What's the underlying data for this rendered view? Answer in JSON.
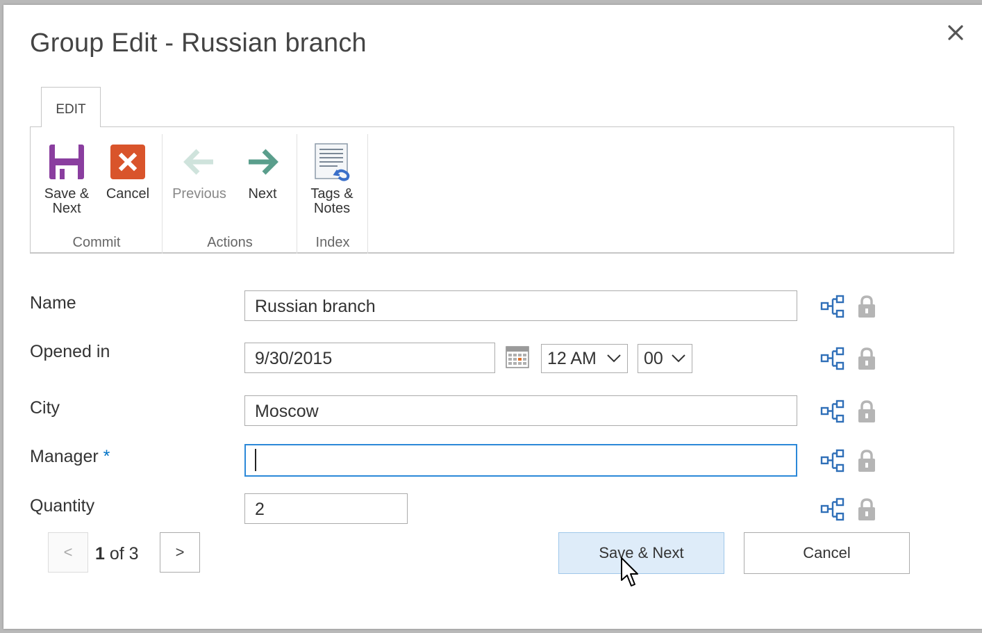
{
  "dialog": {
    "title": "Group Edit - Russian branch",
    "close_icon": "close-icon"
  },
  "ribbon": {
    "tab": "EDIT",
    "groups": [
      {
        "label": "Commit",
        "buttons": [
          {
            "label": "Save & Next",
            "icon": "floppy-disk-icon",
            "color": "#8a3e9f"
          },
          {
            "label": "Cancel",
            "icon": "cancel-x-icon",
            "color": "#d9542b"
          }
        ]
      },
      {
        "label": "Actions",
        "buttons": [
          {
            "label": "Previous",
            "icon": "arrow-left-icon",
            "enabled": false
          },
          {
            "label": "Next",
            "icon": "arrow-right-icon",
            "color": "#5a9e8c"
          }
        ]
      },
      {
        "label": "Index",
        "buttons": [
          {
            "label": "Tags & Notes",
            "icon": "tags-notes-icon"
          }
        ]
      }
    ]
  },
  "form": {
    "name": {
      "label": "Name",
      "value": "Russian branch"
    },
    "opened_in": {
      "label": "Opened in",
      "date": "9/30/2015",
      "hour": "12 AM",
      "minute": "00"
    },
    "city": {
      "label": "City",
      "value": "Moscow"
    },
    "manager": {
      "label": "Manager",
      "required_mark": "*",
      "value": ""
    },
    "quantity": {
      "label": "Quantity",
      "value": "2"
    }
  },
  "pager": {
    "prev": "<",
    "next": ">",
    "current": "1",
    "of_text": "of 3"
  },
  "footer": {
    "save_next": "Save & Next",
    "cancel": "Cancel"
  },
  "colors": {
    "accent_blue": "#2b88d8",
    "primary_button_bg": "#deecf9"
  }
}
